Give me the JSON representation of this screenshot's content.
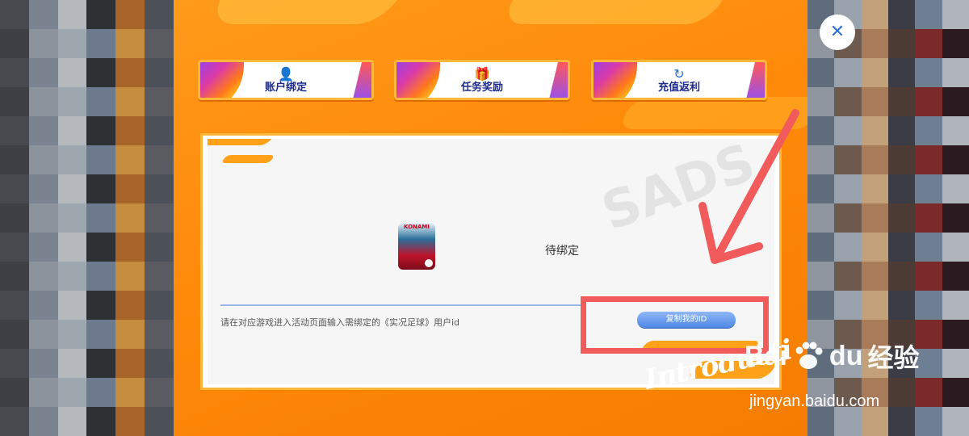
{
  "tabs": [
    {
      "label": "账户绑定",
      "icon": "user-link-icon"
    },
    {
      "label": "任务奖励",
      "icon": "gift-icon"
    },
    {
      "label": "充值返利",
      "icon": "refund-icon"
    }
  ],
  "card": {
    "game_brand": "KONAMI",
    "status": "待绑定",
    "hint": "请在对应游戏进入活动页面输入需绑定的《实况足球》用户id",
    "copy_button": "复制我的ID",
    "watermark": "SADS",
    "intro_script": "Introducti"
  },
  "close_label": "✕",
  "baidu": {
    "word_bai": "Bai",
    "word_du": "du",
    "cn": "经验",
    "url": "jingyan.baidu.com"
  },
  "colors": {
    "panel": "#ff8a0a",
    "accent_blue": "#2f6fd8",
    "annotation_red": "#f25b5b",
    "tab_text": "#1b2a8f"
  }
}
